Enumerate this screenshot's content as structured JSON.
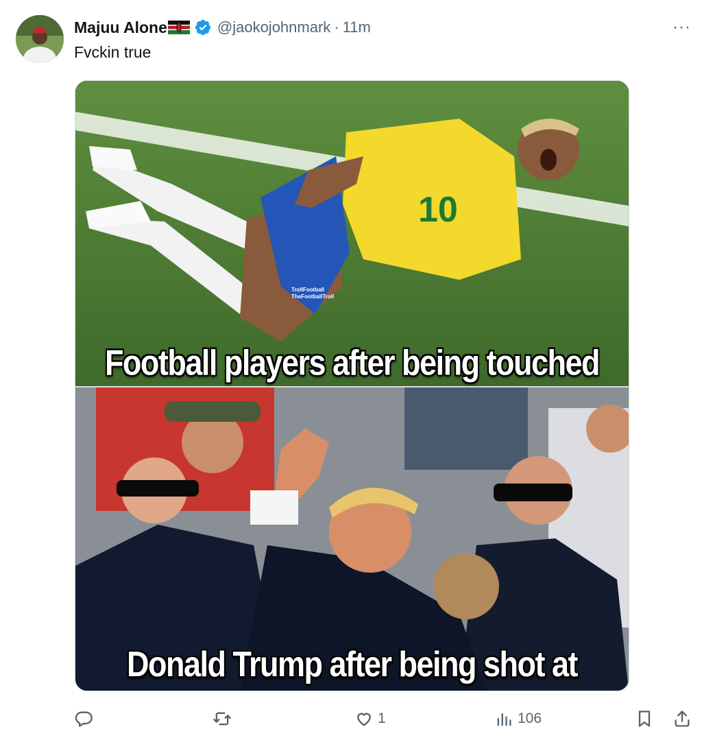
{
  "post": {
    "author_name": "Majuu Alone",
    "handle": "@jaokojohnmark",
    "separator": "·",
    "time": "11m",
    "text": "Fvckin true",
    "more_label": "···"
  },
  "meme": {
    "top_caption": "Football players after being touched",
    "bottom_caption": "Donald Trump after being shot at",
    "watermark_line1": "TrollFootball",
    "watermark_line2": "TheFootballTroll",
    "jersey_number": "10"
  },
  "actions": {
    "reply_count": "",
    "repost_count": "",
    "like_count": "1",
    "views_count": "106"
  },
  "colors": {
    "verified": "#1d9bf0",
    "muted": "#536471",
    "pitch": "#4f7d36"
  },
  "icons": [
    "verified-icon",
    "kenya-flag-icon",
    "more-icon",
    "reply-icon",
    "repost-icon",
    "like-icon",
    "views-icon",
    "bookmark-icon",
    "share-icon"
  ]
}
